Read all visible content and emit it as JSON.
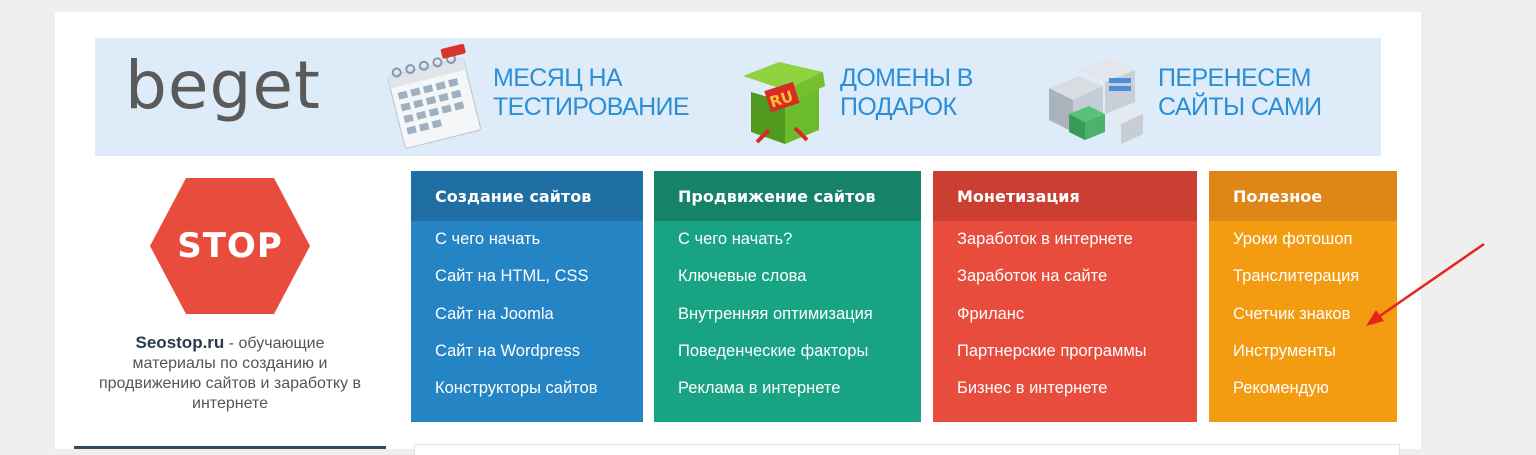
{
  "banner": {
    "logo_text": "beget",
    "promos": [
      {
        "line1": "МЕСЯЦ НА",
        "line2": "ТЕСТИРОВАНИЕ",
        "icon": "calendar-icon"
      },
      {
        "line1": "ДОМЕНЫ В",
        "line2": "ПОДАРОК",
        "icon": "gift-box-icon"
      },
      {
        "line1": "ПЕРЕНЕСЕМ",
        "line2": "САЙТЫ САМИ",
        "icon": "server-boxes-icon"
      }
    ],
    "ru_label": "RU",
    "colors": {
      "background": "#deecf9",
      "promo_text": "#2c8fd6"
    }
  },
  "sidebar": {
    "stop_label": "STOP",
    "site_name": "Seostop.ru",
    "description": " - обучающие материалы по созданию и продвижению сайтов и заработку в интернете",
    "stop_color": "#e84c3d"
  },
  "menu": [
    {
      "title": "Создание сайтов",
      "color": "#2584c4",
      "items": [
        "С чего начать",
        "Сайт на HTML, CSS",
        "Сайт на Joomla",
        "Сайт на Wordpress",
        "Конструкторы сайтов"
      ]
    },
    {
      "title": "Продвижение сайтов",
      "color": "#18a384",
      "items": [
        "С чего начать?",
        "Ключевые слова",
        "Внутренняя оптимизация",
        "Поведенческие факторы",
        "Реклама в интернете"
      ]
    },
    {
      "title": "Монетизация",
      "color": "#e74c3c",
      "items": [
        "Заработок в интернете",
        "Заработок на сайте",
        "Фриланс",
        "Партнерские программы",
        "Бизнес в интернете"
      ]
    },
    {
      "title": "Полезное",
      "color": "#f39c12",
      "items": [
        "Уроки фотошоп",
        "Транслитерация",
        "Счетчик знаков",
        "Инструменты",
        "Рекомендую"
      ]
    }
  ],
  "annotation": {
    "arrow_color": "#e8221f",
    "points_to": "Счетчик знаков"
  }
}
